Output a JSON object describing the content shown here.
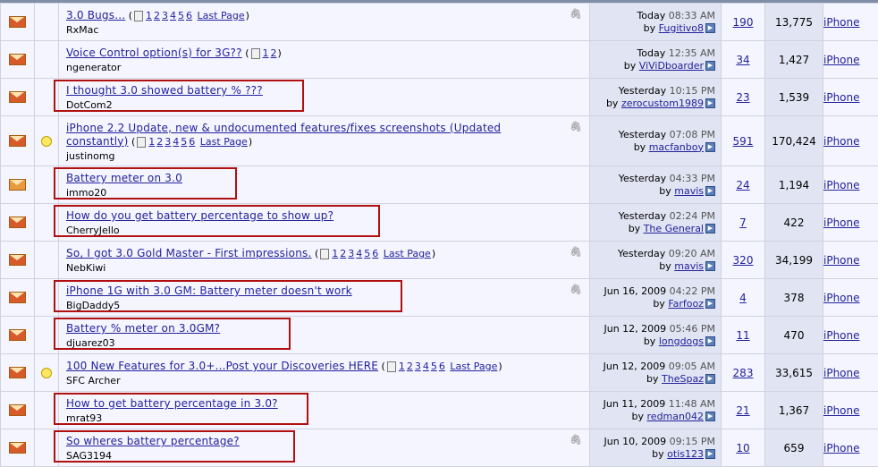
{
  "threads": [
    {
      "title": "3.0 Bugs...",
      "pages": [
        "1",
        "2",
        "3",
        "4",
        "5",
        "6"
      ],
      "last_page": "Last Page",
      "author": "RxMac",
      "attach": true,
      "bulb": false,
      "hot": true,
      "date": "Today",
      "time": "08:33 AM",
      "by": "by",
      "last_poster": "Fugitivo8",
      "replies": "190",
      "views": "13,775",
      "forum": "iPhone",
      "boxed": false
    },
    {
      "title": "Voice Control option(s) for 3G??",
      "pages": [
        "1",
        "2"
      ],
      "last_page": "",
      "author": "ngenerator",
      "attach": false,
      "bulb": false,
      "hot": true,
      "date": "Today",
      "time": "12:35 AM",
      "by": "by",
      "last_poster": "ViViDboarder",
      "replies": "34",
      "views": "1,427",
      "forum": "iPhone",
      "boxed": false
    },
    {
      "title": "I thought 3.0 showed battery % ???",
      "pages": [],
      "last_page": "",
      "author": "DotCom2",
      "attach": false,
      "bulb": false,
      "hot": true,
      "date": "Yesterday",
      "time": "10:15 PM",
      "by": "by",
      "last_poster": "zerocustom1989",
      "replies": "23",
      "views": "1,539",
      "forum": "iPhone",
      "boxed": true
    },
    {
      "title": "iPhone 2.2 Update, new & undocumented features/fixes screenshots (Updated constantly)",
      "pages": [
        "1",
        "2",
        "3",
        "4",
        "5",
        "6"
      ],
      "last_page": "Last Page",
      "author": "justinomg",
      "attach": true,
      "bulb": true,
      "hot": true,
      "date": "Yesterday",
      "time": "07:08 PM",
      "by": "by",
      "last_poster": "macfanboy",
      "replies": "591",
      "views": "170,424",
      "forum": "iPhone",
      "boxed": false
    },
    {
      "title": "Battery meter on 3.0",
      "pages": [],
      "last_page": "",
      "author": "immo20",
      "attach": false,
      "bulb": false,
      "hot": false,
      "date": "Yesterday",
      "time": "04:33 PM",
      "by": "by",
      "last_poster": "mavis",
      "replies": "24",
      "views": "1,194",
      "forum": "iPhone",
      "boxed": true
    },
    {
      "title": "How do you get battery percentage to show up?",
      "pages": [],
      "last_page": "",
      "author": "CherryJello",
      "attach": false,
      "bulb": false,
      "hot": true,
      "date": "Yesterday",
      "time": "02:24 PM",
      "by": "by",
      "last_poster": "The General",
      "replies": "7",
      "views": "422",
      "forum": "iPhone",
      "boxed": true
    },
    {
      "title": "So, I got 3.0 Gold Master - First impressions.",
      "pages": [
        "1",
        "2",
        "3",
        "4",
        "5",
        "6"
      ],
      "last_page": "Last Page",
      "author": "NebKiwi",
      "attach": true,
      "bulb": false,
      "hot": true,
      "date": "Yesterday",
      "time": "09:20 AM",
      "by": "by",
      "last_poster": "mavis",
      "replies": "320",
      "views": "34,199",
      "forum": "iPhone",
      "boxed": false
    },
    {
      "title": "iPhone 1G with 3.0 GM: Battery meter doesn't work",
      "pages": [],
      "last_page": "",
      "author": "BigDaddy5",
      "attach": true,
      "bulb": false,
      "hot": true,
      "date": "Jun 16, 2009",
      "time": "04:22 PM",
      "by": "by",
      "last_poster": "Farfooz",
      "replies": "4",
      "views": "378",
      "forum": "iPhone",
      "boxed": true
    },
    {
      "title": "Battery % meter on 3.0GM?",
      "pages": [],
      "last_page": "",
      "author": "djuarez03",
      "attach": false,
      "bulb": false,
      "hot": true,
      "date": "Jun 12, 2009",
      "time": "05:46 PM",
      "by": "by",
      "last_poster": "longdogs",
      "replies": "11",
      "views": "470",
      "forum": "iPhone",
      "boxed": true
    },
    {
      "title": "100 New Features for 3.0+...Post your Discoveries HERE",
      "pages": [
        "1",
        "2",
        "3",
        "4",
        "5",
        "6"
      ],
      "last_page": "Last Page",
      "author": "SFC Archer",
      "attach": false,
      "bulb": true,
      "hot": true,
      "date": "Jun 12, 2009",
      "time": "09:05 AM",
      "by": "by",
      "last_poster": "TheSpaz",
      "replies": "283",
      "views": "33,615",
      "forum": "iPhone",
      "boxed": false
    },
    {
      "title": "How to get battery percentage in 3.0?",
      "pages": [],
      "last_page": "",
      "author": "mrat93",
      "attach": false,
      "bulb": false,
      "hot": true,
      "date": "Jun 11, 2009",
      "time": "11:48 AM",
      "by": "by",
      "last_poster": "redman042",
      "replies": "21",
      "views": "1,367",
      "forum": "iPhone",
      "boxed": true
    },
    {
      "title": "So wheres battery percentage?",
      "pages": [],
      "last_page": "",
      "author": "SAG3194",
      "attach": true,
      "bulb": false,
      "hot": true,
      "date": "Jun 10, 2009",
      "time": "09:15 PM",
      "by": "by",
      "last_poster": "otis123",
      "replies": "10",
      "views": "659",
      "forum": "iPhone",
      "boxed": true
    }
  ],
  "icons": {
    "status": "envelope-icon",
    "bulb": "lightbulb-icon",
    "attachment": "paperclip-icon",
    "goto": "go-to-last-post-icon",
    "multipage": "multipage-icon"
  },
  "colors": {
    "link": "#22229c",
    "row_light": "#f5f5ff",
    "row_dark": "#e1e4f2",
    "highlight_box": "#b01010"
  }
}
